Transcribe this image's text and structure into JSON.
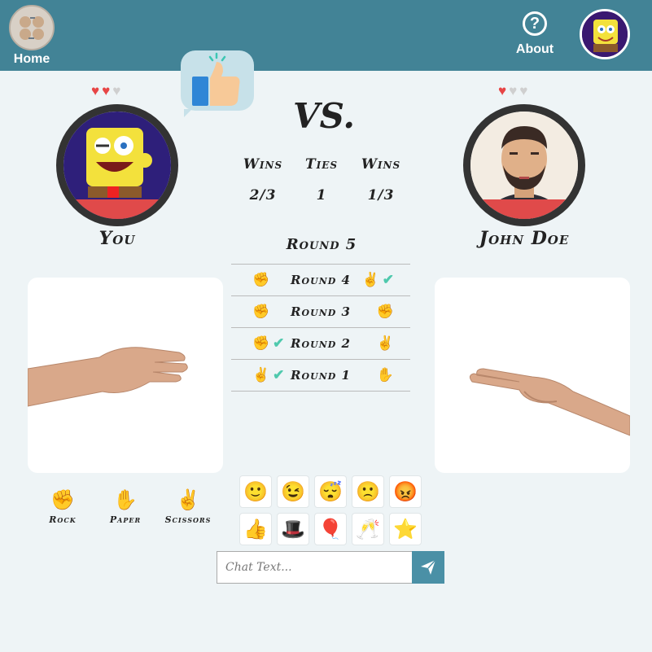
{
  "nav": {
    "home_label": "Home",
    "about_label": "About",
    "about_symbol": "?"
  },
  "players": {
    "you": {
      "name": "You",
      "hearts": [
        "♥",
        "♥",
        "♥"
      ],
      "lives": 2
    },
    "opponent": {
      "name": "John Doe",
      "hearts": [
        "♥",
        "♥",
        "♥"
      ],
      "lives": 1
    }
  },
  "vs_label": "VS.",
  "scores": {
    "you_wins": {
      "label": "Wins",
      "value": "2/3"
    },
    "ties": {
      "label": "Ties",
      "value": "1"
    },
    "opp_wins": {
      "label": "Wins",
      "value": "1/3"
    }
  },
  "current_round": "Round 5",
  "rounds": [
    {
      "label": "Round 4",
      "you_icon": "rock-icon",
      "opp_icon": "scissors-icon",
      "winner": "opponent",
      "you_glyph": "✊",
      "opp_glyph": "✌",
      "check": "✔"
    },
    {
      "label": "Round 3",
      "you_icon": "rock-icon",
      "opp_icon": "rock-icon",
      "winner": "tie",
      "you_glyph": "✊",
      "opp_glyph": "✊",
      "check": ""
    },
    {
      "label": "Round 2",
      "you_icon": "rock-icon",
      "opp_icon": "scissors-icon",
      "winner": "you",
      "you_glyph": "✊",
      "opp_glyph": "✌",
      "check": "✔"
    },
    {
      "label": "Round 1",
      "you_icon": "scissors-icon",
      "opp_icon": "paper-icon",
      "winner": "you",
      "you_glyph": "✌",
      "opp_glyph": "✋",
      "check": "✔"
    }
  ],
  "choices": [
    {
      "label": "Rock",
      "icon": "rock-icon",
      "glyph": "✊"
    },
    {
      "label": "Paper",
      "icon": "paper-icon",
      "glyph": "✋"
    },
    {
      "label": "Scissors",
      "icon": "scissors-icon",
      "glyph": "✌"
    }
  ],
  "emojis": [
    {
      "name": "smile-emoji",
      "glyph": "🙂"
    },
    {
      "name": "wink-emoji",
      "glyph": "😉"
    },
    {
      "name": "sleepy-emoji",
      "glyph": "😴"
    },
    {
      "name": "frown-emoji",
      "glyph": "🙁"
    },
    {
      "name": "angry-emoji",
      "glyph": "😡"
    },
    {
      "name": "thumbs-up-emoji",
      "glyph": "👍"
    },
    {
      "name": "magic-hat-emoji",
      "glyph": "🎩"
    },
    {
      "name": "balloons-emoji",
      "glyph": "🎈"
    },
    {
      "name": "cheers-emoji",
      "glyph": "🥂"
    },
    {
      "name": "star-emoji",
      "glyph": "⭐"
    }
  ],
  "chat": {
    "placeholder": "Chat Text..."
  },
  "colors": {
    "topbar": "#428396",
    "heart_active": "#e74545",
    "heart_inactive": "#cfcfcf",
    "check": "#4fc9ad",
    "send_button": "#4a90a6"
  }
}
